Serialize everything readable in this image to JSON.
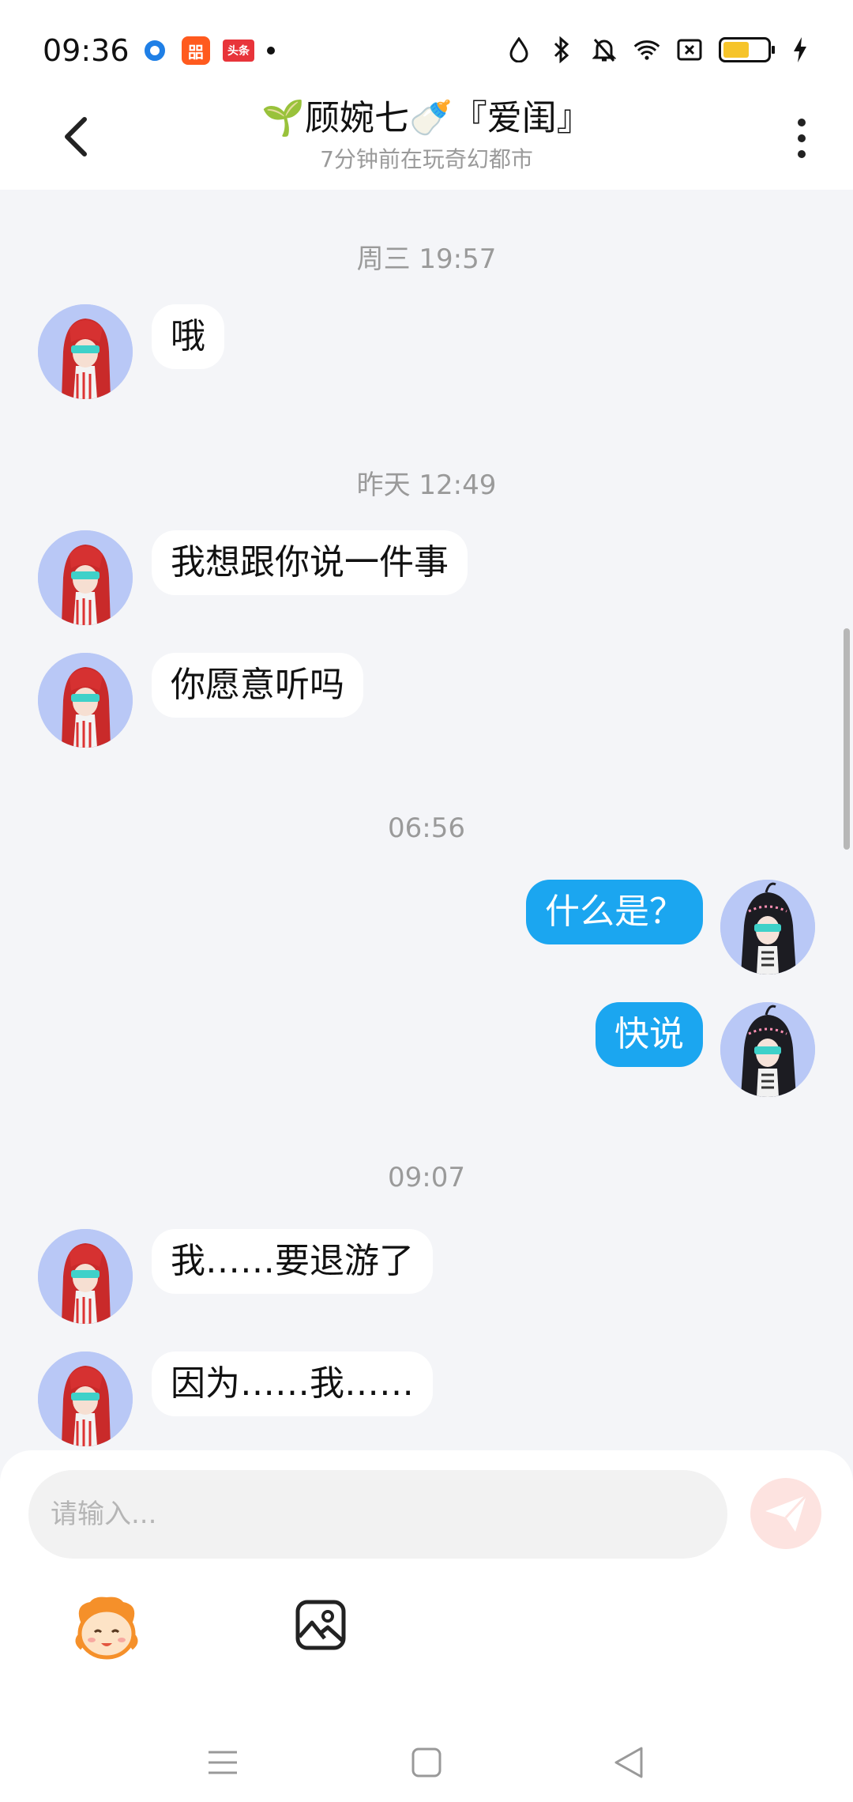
{
  "status_bar": {
    "time": "09:36",
    "app_icons": [
      "browser-icon",
      "kuaishou-icon",
      "toutiao-icon"
    ],
    "toutiao_label": "头条",
    "ks_label": "㗊",
    "battery_color": "#f6c42a"
  },
  "header": {
    "title": "🌱顾婉七🍼『爱闺』",
    "subtitle": "7分钟前在玩奇幻都市"
  },
  "messages": [
    {
      "type": "time",
      "text": "周三 19:57"
    },
    {
      "type": "in",
      "text": "哦"
    },
    {
      "type": "time",
      "text": "昨天 12:49"
    },
    {
      "type": "in",
      "text": "我想跟你说一件事"
    },
    {
      "type": "in",
      "text": "你愿意听吗"
    },
    {
      "type": "time",
      "text": "06:56"
    },
    {
      "type": "out",
      "text": "什么是？"
    },
    {
      "type": "out",
      "text": "快说"
    },
    {
      "type": "time",
      "text": "09:07"
    },
    {
      "type": "in",
      "text": "我……要退游了"
    },
    {
      "type": "in",
      "text": "因为……我……"
    }
  ],
  "input": {
    "placeholder": "请输入..."
  },
  "colors": {
    "accent": "#1ba6f0",
    "send_disabled": "#fde3e0",
    "background": "#f4f5f8"
  }
}
